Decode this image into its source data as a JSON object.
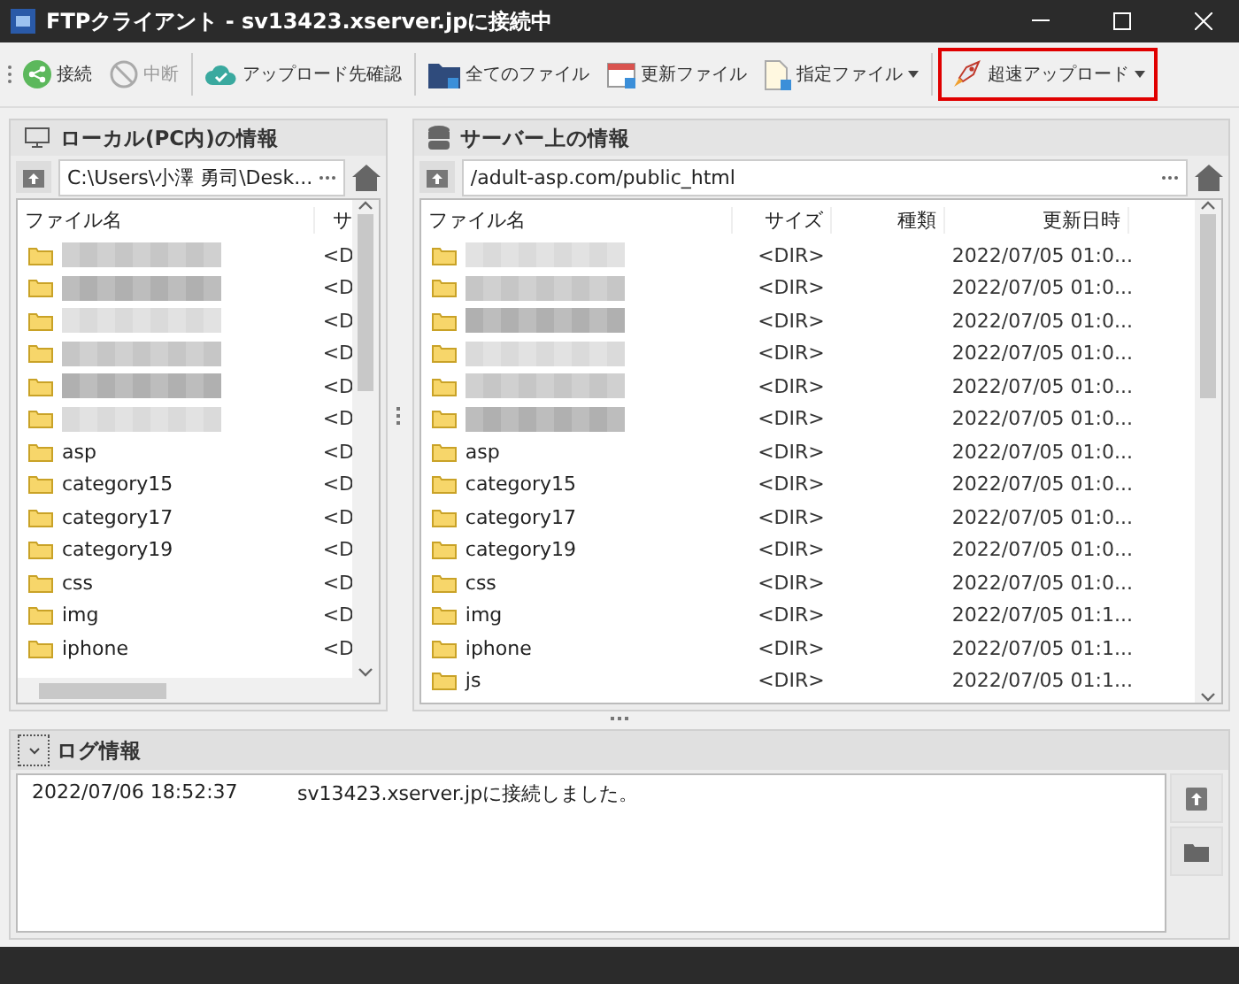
{
  "window": {
    "title": "FTPクライアント - sv13423.xserver.jpに接続中"
  },
  "toolbar": [
    {
      "label": "接続",
      "disabled": false,
      "dropdown": false,
      "highlighted": false
    },
    {
      "label": "中断",
      "disabled": true,
      "dropdown": false,
      "highlighted": false
    },
    {
      "label": "アップロード先確認",
      "disabled": false,
      "dropdown": false,
      "highlighted": false
    },
    {
      "label": "全てのファイル",
      "disabled": false,
      "dropdown": false,
      "highlighted": false
    },
    {
      "label": "更新ファイル",
      "disabled": false,
      "dropdown": false,
      "highlighted": false
    },
    {
      "label": "指定ファイル",
      "disabled": false,
      "dropdown": true,
      "highlighted": false
    },
    {
      "label": "超速アップロード",
      "disabled": false,
      "dropdown": true,
      "highlighted": true
    }
  ],
  "local": {
    "title": "ローカル(PC内)の情報",
    "path": "C:\\Users\\小澤 勇司\\Desk...",
    "columns": [
      "ファイル名",
      "サ"
    ],
    "rows": [
      {
        "blurred": true,
        "name": "",
        "size": "<D"
      },
      {
        "blurred": true,
        "name": "",
        "size": "<D"
      },
      {
        "blurred": true,
        "name": "",
        "size": "<D"
      },
      {
        "blurred": true,
        "name": "",
        "size": "<D"
      },
      {
        "blurred": true,
        "name": "",
        "size": "<D"
      },
      {
        "blurred": true,
        "name": "",
        "size": "<D"
      },
      {
        "blurred": false,
        "name": "asp",
        "size": "<D"
      },
      {
        "blurred": false,
        "name": "category15",
        "size": "<D"
      },
      {
        "blurred": false,
        "name": "category17",
        "size": "<D"
      },
      {
        "blurred": false,
        "name": "category19",
        "size": "<D"
      },
      {
        "blurred": false,
        "name": "css",
        "size": "<D"
      },
      {
        "blurred": false,
        "name": "img",
        "size": "<D"
      },
      {
        "blurred": false,
        "name": "iphone",
        "size": "<D"
      }
    ]
  },
  "server": {
    "title": "サーバー上の情報",
    "path": "/adult-asp.com/public_html",
    "columns": [
      "ファイル名",
      "サイズ",
      "種類",
      "更新日時"
    ],
    "rows": [
      {
        "blurred": true,
        "name": "",
        "size": "<DIR>",
        "modified": "2022/07/05 01:0..."
      },
      {
        "blurred": true,
        "name": "",
        "size": "<DIR>",
        "modified": "2022/07/05 01:0..."
      },
      {
        "blurred": true,
        "name": "",
        "size": "<DIR>",
        "modified": "2022/07/05 01:0..."
      },
      {
        "blurred": true,
        "name": "",
        "size": "<DIR>",
        "modified": "2022/07/05 01:0..."
      },
      {
        "blurred": true,
        "name": "",
        "size": "<DIR>",
        "modified": "2022/07/05 01:0..."
      },
      {
        "blurred": true,
        "name": "",
        "size": "<DIR>",
        "modified": "2022/07/05 01:0..."
      },
      {
        "blurred": false,
        "name": "asp",
        "size": "<DIR>",
        "modified": "2022/07/05 01:0..."
      },
      {
        "blurred": false,
        "name": "category15",
        "size": "<DIR>",
        "modified": "2022/07/05 01:0..."
      },
      {
        "blurred": false,
        "name": "category17",
        "size": "<DIR>",
        "modified": "2022/07/05 01:0..."
      },
      {
        "blurred": false,
        "name": "category19",
        "size": "<DIR>",
        "modified": "2022/07/05 01:0..."
      },
      {
        "blurred": false,
        "name": "css",
        "size": "<DIR>",
        "modified": "2022/07/05 01:0..."
      },
      {
        "blurred": false,
        "name": "img",
        "size": "<DIR>",
        "modified": "2022/07/05 01:1..."
      },
      {
        "blurred": false,
        "name": "iphone",
        "size": "<DIR>",
        "modified": "2022/07/05 01:1..."
      },
      {
        "blurred": false,
        "name": "js",
        "size": "<DIR>",
        "modified": "2022/07/05 01:1..."
      }
    ]
  },
  "log": {
    "title": "ログ情報",
    "expanded": true,
    "entries": [
      {
        "time": "2022/07/06 18:52:37",
        "message": "sv13423.xserver.jpに接続しました。"
      }
    ]
  }
}
